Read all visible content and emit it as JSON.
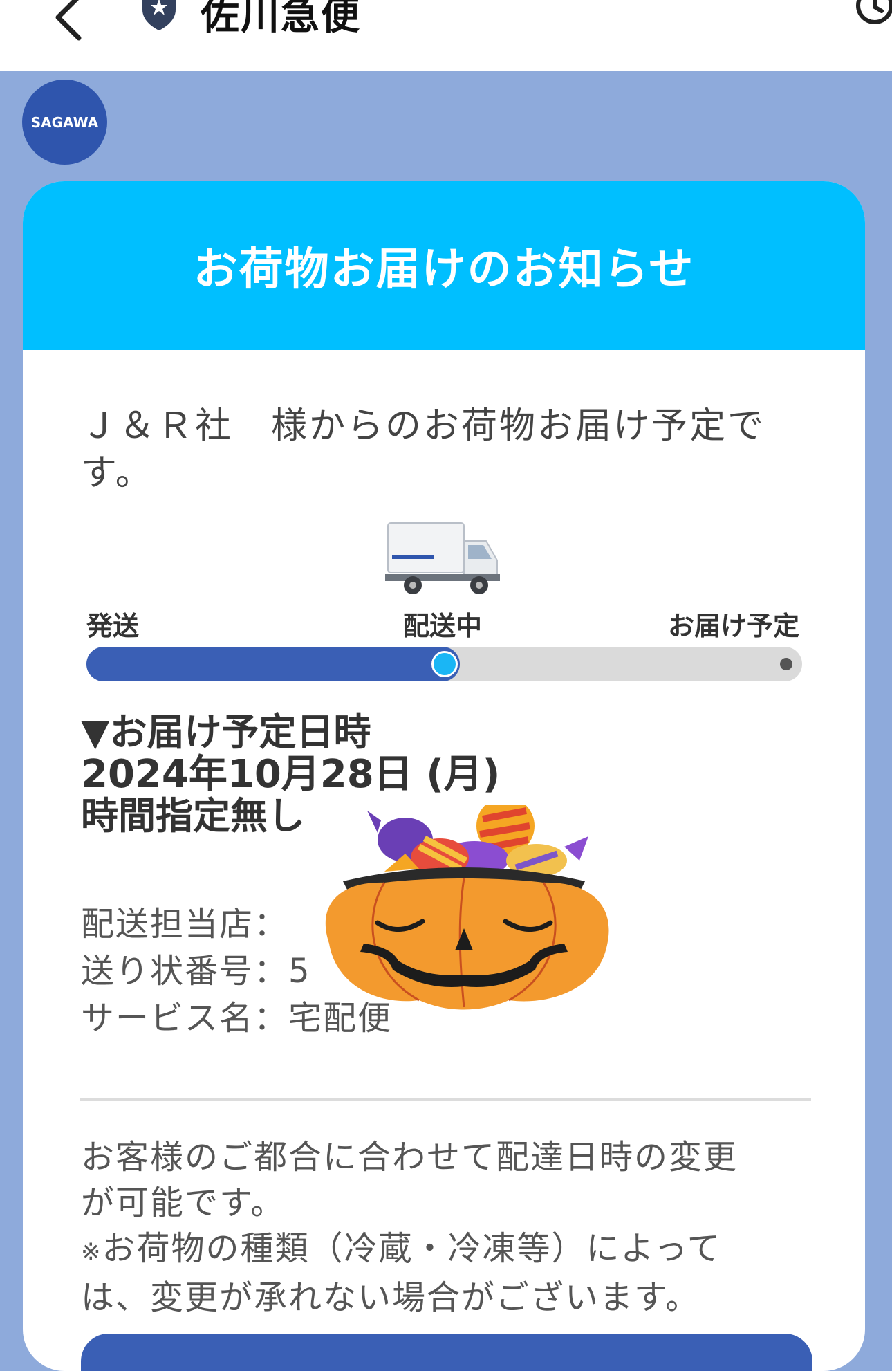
{
  "header": {
    "back_icon": "chevron-left-icon",
    "badge_icon": "shield-star-icon",
    "title": "佐川急便",
    "clock_icon": "clock-icon"
  },
  "avatar": {
    "label": "SAGAWA"
  },
  "card": {
    "header_title": "お荷物お届けのお知らせ",
    "intro_line1": "Ｊ＆Ｒ社　様からのお荷物お届け予定で",
    "intro_line2": "す。",
    "truck_icon": "delivery-truck-icon",
    "progress": {
      "stages": [
        "発送",
        "配送中",
        "お届け予定"
      ],
      "current_stage": "配送中",
      "fraction": 0.5
    },
    "delivery": {
      "heading": "▼お届け予定日時",
      "date": "2024年10月28日 (月)",
      "time": "時間指定無し"
    },
    "info_rows": [
      {
        "label": "配送担当店：",
        "value": ""
      },
      {
        "label": "送り状番号：",
        "value": "5"
      },
      {
        "label": "サービス名：",
        "value": "宅配便"
      }
    ],
    "notice": {
      "line1": "お客様のご都合に合わせて配達日時の変更",
      "line2": "が可能です。",
      "mark": "※",
      "line3": "お荷物の種類（冷蔵・冷凍等）によって",
      "line4": "は、変更が承れない場合がございます。"
    }
  },
  "colors": {
    "background": "#8eaadb",
    "header_band": "#00bfff",
    "progress_fill": "#3a5fb5",
    "progress_dot": "#1ab6f5",
    "avatar": "#2f55ad"
  },
  "sticker_icon": "halloween-pumpkin-candy-sticker"
}
